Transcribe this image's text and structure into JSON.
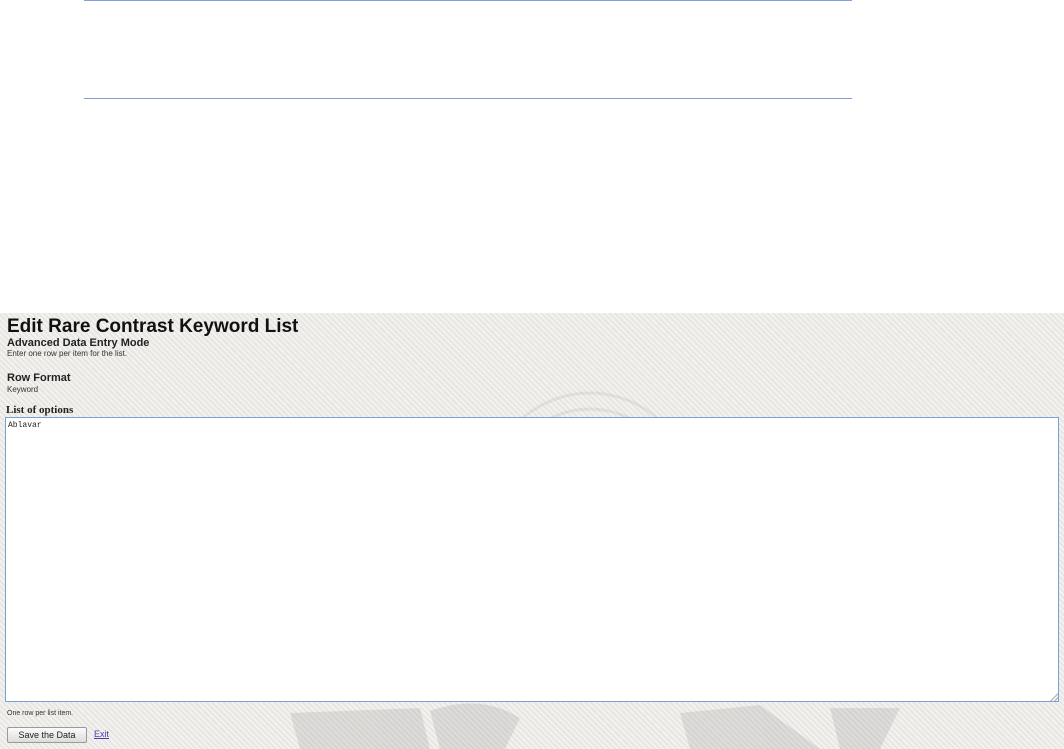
{
  "editor": {
    "title": "Edit Rare Contrast Keyword List",
    "mode_heading": "Advanced Data Entry Mode",
    "mode_description": "Enter one row per item for the list.",
    "row_format_heading": "Row Format",
    "row_format_value": "Keyword",
    "list_heading": "List of options",
    "list_value": "Ablavar",
    "list_hint": "One row per list item.",
    "save_label": "Save the Data",
    "exit_label": "Exit"
  },
  "colors": {
    "panel_background": "#ecebe7",
    "textarea_border": "#7a9fd9",
    "rule_lines": "#7f9fd8",
    "link": "#4a3fb0"
  },
  "icons": {
    "watermark": "seal-watermark-icon",
    "resize": "resize-grip-icon"
  }
}
